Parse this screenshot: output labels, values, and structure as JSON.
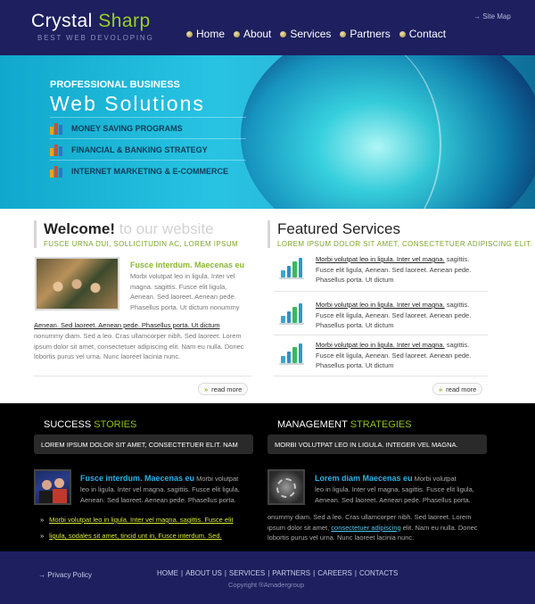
{
  "header": {
    "logo_part1": "Crystal ",
    "logo_part2": "Sharp",
    "tagline": "BEST WEB DEVOLOPING",
    "sitemap": "Site Map",
    "nav": [
      "Home",
      "About",
      "Services",
      "Partners",
      "Contact"
    ]
  },
  "banner": {
    "kicker": "PROFESSIONAL BUSINESS",
    "title": "Web Solutions",
    "items": [
      "MONEY SAVING PROGRAMS",
      "FINANCIAL & BANKING STRATEGY",
      "INTERNET MARKETING & E-COMMERCE"
    ]
  },
  "welcome": {
    "heading_bold": "Welcome!",
    "heading_light": " to our website",
    "subheading": "FUSCE URNA DUI, SOLLICITUDIN AC, LOREM IPSUM",
    "item_title": "Fusce interdum. Maecenas eu",
    "item_text": "Morbi volutpat leo in ligula. Inter vel magna. sagittis. Fusce elit ligula, Aenean. Sed laoreet. Aenean pede. Phasellus porta. Ut dictum nonummy",
    "link_text": "Aenean. Sed laoreet. Aenean pede. Phasellus porta. Ut dictum",
    "body_text": "nonummy diam. Sed a leo. Cras ullamcorper nibh. Sed laoreet. Lorem ipsum dolor sit amet, consectetuer adipiscing elit. Nam eu nulla. Donec lobortis purus vel urna. Nunc laoreet lacinia nunc.",
    "read_more": "read more"
  },
  "services": {
    "heading": "Featured Services",
    "subheading": "LOREM IPSUM DOLOR SIT AMET, CONSECTETUER ADIPISCING ELIT.",
    "items": [
      {
        "link": "Morbi volutpat leo in ligula. Inter vel magna.",
        "text": " sagittis. Fusce elit ligula,  Aenean. Sed laoreet. Aenean pede. Phasellus porta. Ut dictum"
      },
      {
        "link": "Morbi volutpat leo in ligula. Inter vel magna.",
        "text": " sagittis. Fusce elit ligula,  Aenean. Sed laoreet. Aenean pede. Phasellus porta. Ut dictum"
      },
      {
        "link": "Morbi volutpat leo in ligula. Inter vel magna.",
        "text": " sagittis. Fusce elit ligula,  Aenean. Sed laoreet. Aenean pede. Phasellus porta. Ut dictum"
      }
    ],
    "read_more": "read more"
  },
  "success": {
    "heading_white": "SUCCESS ",
    "heading_green": "STORIES",
    "box": "LOREM IPSUM DOLOR SIT AMET, CONSECTETUER ELIT. NAM",
    "item_title": "Fusce interdum. Maecenas eu",
    "item_text_inline": "  Morbi volutpat",
    "item_text": "leo in ligula. Inter vel magna. sagittis. Fusce elit ligula, Aenean. Sed laoreet. Aenean pede. Phasellus porta.",
    "links": [
      "Morbi volutpat leo in ligula. Inter vel magna. sagittis. Fusce elit",
      "ligula, sodales sit amet, tincid unt in, Fusce interdum. Sed."
    ]
  },
  "management": {
    "heading_white": "MANAGEMENT ",
    "heading_green": "STRATEGIES",
    "box": "MORBI VOLUTPAT LEO IN LIGULA. INTEGER VEL MAGNA.",
    "item_title": "Lorem diam Maecenas eu",
    "item_text_inline": "  Morbi volutpat",
    "item_text": "leo in ligula. Inter vel magna. sagittis. Fusce elit ligula, Aenean. Sed laoreet. Aenean pede. Phasellus porta.",
    "body_text_1": "onummy diam. Sed a leo. Cras ullamcorper nibh. Sed laoreet. Lorem ipsum dolor sit amet, ",
    "body_link": "consectetuer adipiscing",
    "body_text_2": " elit. Nam eu nulla. Donec lobortis purus vel urna. Nunc laoreet lacinia nunc."
  },
  "footer": {
    "privacy": "Privacy Policy",
    "nav": [
      "HOME",
      "ABOUT US",
      "SERVICES",
      "PARTNERS",
      "CAREERS",
      "CONTACTS"
    ],
    "copyright": "Copyright ®Amadergroup"
  },
  "colors": {
    "header_bg": "#1d1f5e",
    "accent_green": "#8ab72d",
    "accent_blue": "#2db3e6"
  }
}
